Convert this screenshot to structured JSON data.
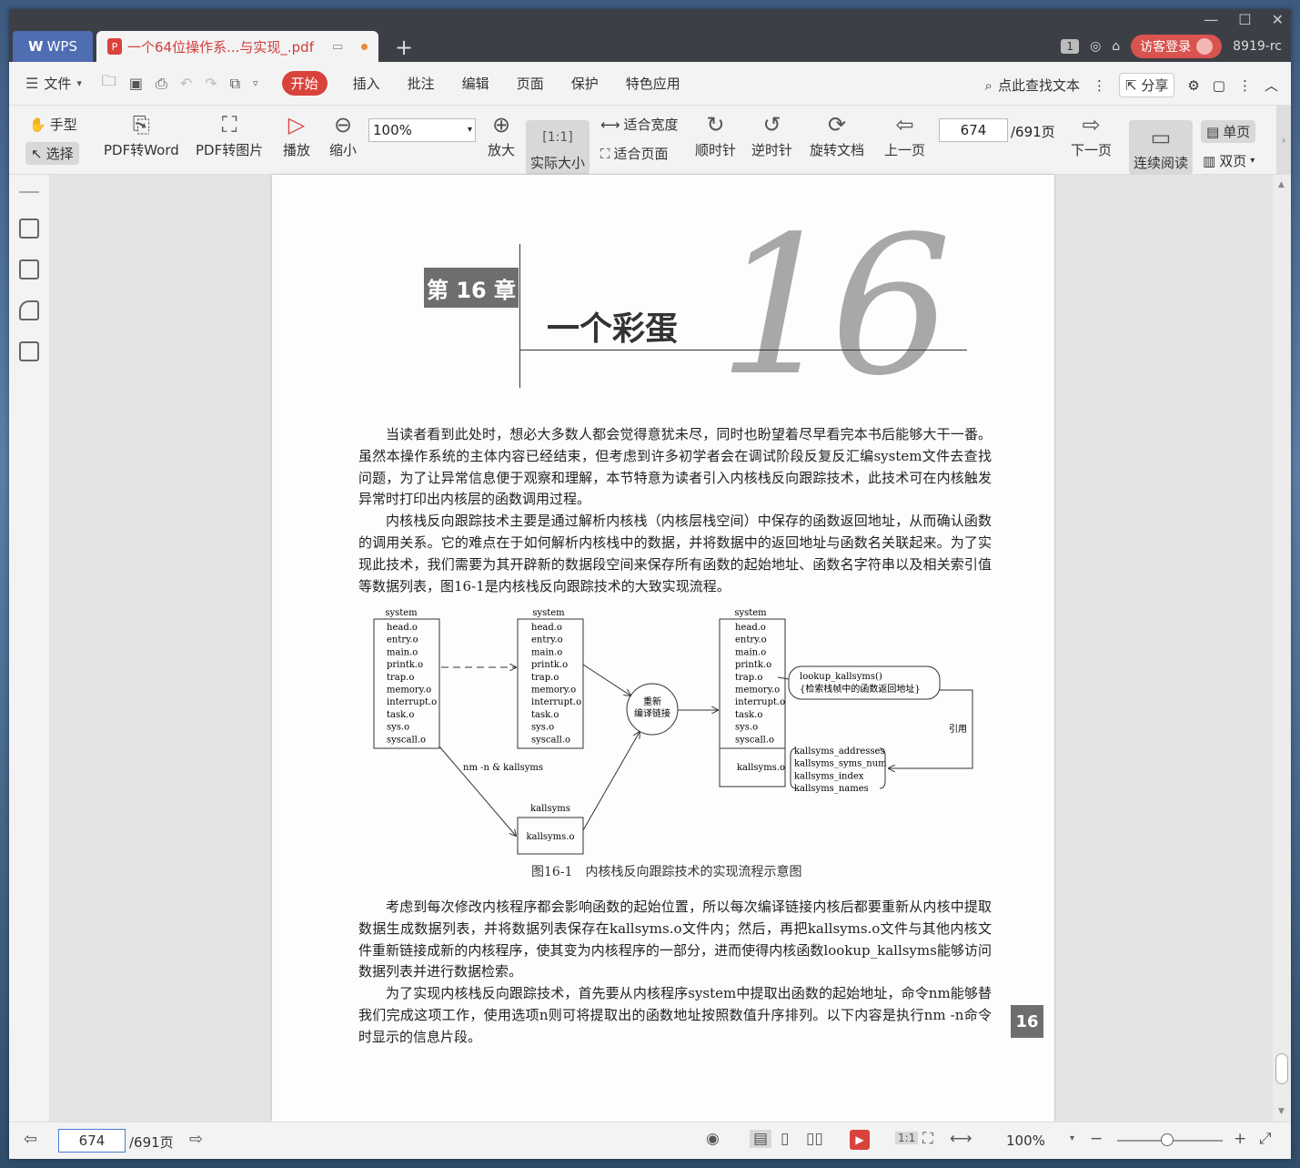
{
  "titlebar": {
    "app_label": "WPS",
    "doc_tab_label": "一个64位操作系...与实现_.pdf",
    "new_tab": "+",
    "page_count_badge": "1",
    "login_label": "访客登录",
    "user_id": "8919-rc"
  },
  "menubar": {
    "file": "文件",
    "tabs": [
      "开始",
      "插入",
      "批注",
      "编辑",
      "页面",
      "保护",
      "特色应用"
    ],
    "search": "点此查找文本",
    "share": "分享"
  },
  "toolbar": {
    "hand": "手型",
    "select": "选择",
    "pdf_to_word": "PDF转Word",
    "pdf_to_image": "PDF转图片",
    "play": "播放",
    "zoom_out": "缩小",
    "zoom_value": "100%",
    "zoom_in": "放大",
    "actual_size": "实际大小",
    "fit_width": "适合宽度",
    "fit_page": "适合页面",
    "clockwise": "顺时针",
    "counterclockwise": "逆时针",
    "rotate_doc": "旋转文档",
    "prev_page": "上一页",
    "page_input": "674",
    "page_total": "/691页",
    "next_page": "下一页",
    "continuous": "连续阅读",
    "single": "单页",
    "double": "双页"
  },
  "document": {
    "chapter_label": "第 16 章",
    "chapter_title": "一个彩蛋",
    "chapter_number": "16",
    "para1": "当读者看到此处时，想必大多数人都会觉得意犹未尽，同时也盼望着尽早看完本书后能够大干一番。虽然本操作系统的主体内容已经结束，但考虑到许多初学者会在调试阶段反复反汇编system文件去查找问题，为了让异常信息便于观察和理解，本节特意为读者引入内核栈反向跟踪技术，此技术可在内核触发异常时打印出内核层的函数调用过程。",
    "para2": "内核栈反向跟踪技术主要是通过解析内核栈（内核层栈空间）中保存的函数返回地址，从而确认函数的调用关系。它的难点在于如何解析内核栈中的数据，并将数据中的返回地址与函数名关联起来。为了实现此技术，我们需要为其开辟新的数据段空间来保存所有函数的起始地址、函数名字符串以及相关索引值等数据列表，图16-1是内核栈反向跟踪技术的大致实现流程。",
    "figure": {
      "box_title": "system",
      "files": [
        "head.o",
        "entry.o",
        "main.o",
        "printk.o",
        "trap.o",
        "memory.o",
        "interrupt.o",
        "task.o",
        "sys.o",
        "syscall.o"
      ],
      "nm_label": "nm -n & kallsyms",
      "kallsyms_title": "kallsyms",
      "kallsyms_file": "kallsyms.o",
      "relink_line1": "重新",
      "relink_line2": "编译链接",
      "lookup_line1": "lookup_kallsyms()",
      "lookup_line2": "{检索栈帧中的函数返回地址}",
      "ref_label": "引用",
      "sym_lists": [
        "kallsyms_addresses",
        "kallsyms_syms_num",
        "kallsyms_index",
        "kallsyms_names"
      ]
    },
    "caption": "图16-1　内核栈反向跟踪技术的实现流程示意图",
    "para3": "考虑到每次修改内核程序都会影响函数的起始位置，所以每次编译链接内核后都要重新从内核中提取数据生成数据列表，并将数据列表保存在kallsyms.o文件内；然后，再把kallsyms.o文件与其他内核文件重新链接成新的内核程序，使其变为内核程序的一部分，进而使得内核函数lookup_kallsyms能够访问数据列表并进行数据检索。",
    "para4": "为了实现内核栈反向跟踪技术，首先要从内核程序system中提取出函数的起始地址，命令nm能够替我们完成这项工作，使用选项n则可将提取出的函数地址按照数值升序排列。以下内容是执行nm -n命令时显示的信息片段。",
    "page_tab": "16"
  },
  "statusbar": {
    "page_input": "674",
    "page_total": "/691页",
    "zoom": "100%"
  }
}
